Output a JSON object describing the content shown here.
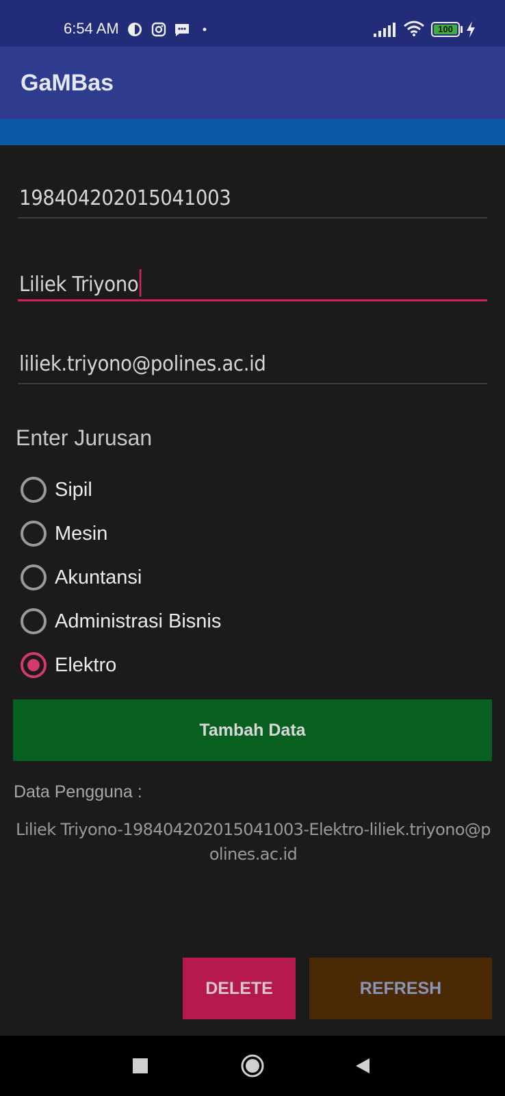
{
  "status_bar": {
    "time": "6:54 AM",
    "battery": "100",
    "icons": [
      "data-saver-icon",
      "instagram-icon",
      "message-icon",
      "dot-icon",
      "signal-icon",
      "wifi-icon",
      "battery-icon",
      "charging-icon"
    ]
  },
  "app_bar": {
    "title": "GaMBas"
  },
  "colors": {
    "status_bar": "#232c78",
    "app_bar": "#2f3b8c",
    "accent_strip": "#0a5aa6",
    "background": "#1b1b1b",
    "accent": "#d0215c",
    "add_button": "#076020",
    "delete_button": "#b5194d",
    "refresh_button": "#4a2a05"
  },
  "form": {
    "nip": {
      "value": "198404202015041003"
    },
    "name": {
      "value": "Liliek Triyono"
    },
    "email": {
      "value": "liliek.triyono@polines.ac.id"
    },
    "jurusan_label": "Enter Jurusan",
    "jurusan_options": [
      {
        "label": "Sipil",
        "checked": false
      },
      {
        "label": "Mesin",
        "checked": false
      },
      {
        "label": "Akuntansi",
        "checked": false
      },
      {
        "label": "Administrasi Bisnis",
        "checked": false
      },
      {
        "label": "Elektro",
        "checked": true
      }
    ],
    "add_button": "Tambah Data"
  },
  "output": {
    "title": "Data Pengguna :",
    "text": "Liliek Triyono-198404202015041003-Elektro-liliek.triyono@polines.ac.id"
  },
  "actions": {
    "delete": "DELETE",
    "refresh": "REFRESH"
  },
  "nav": {
    "recents": "square-recents-icon",
    "home": "circle-home-icon",
    "back": "triangle-back-icon"
  }
}
